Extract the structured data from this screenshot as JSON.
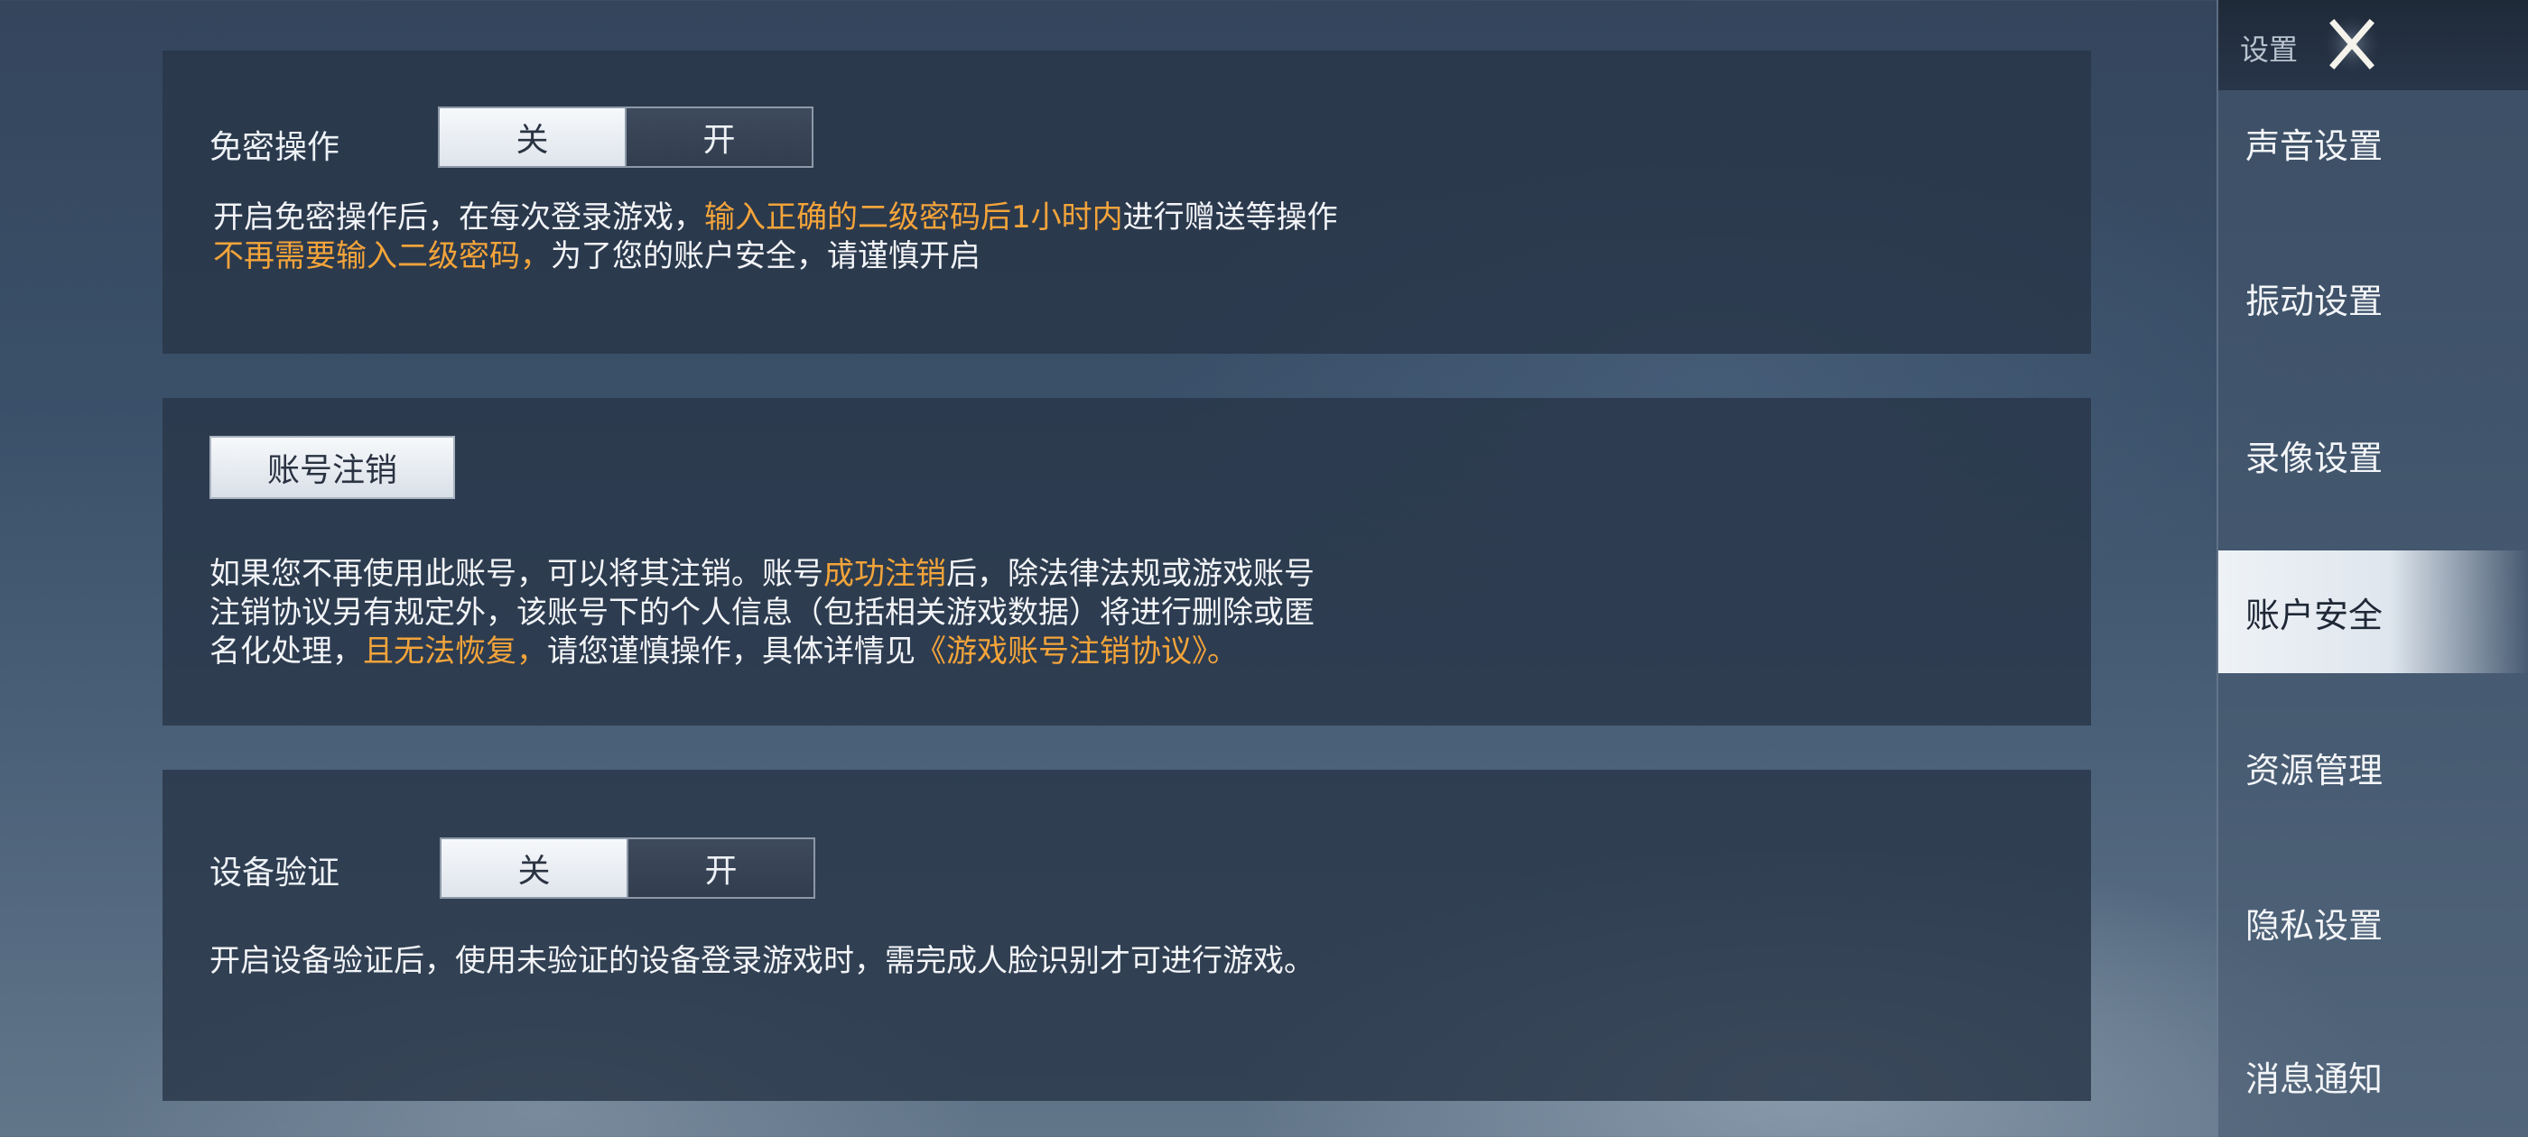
{
  "password_free": {
    "label": "免密操作",
    "toggle": {
      "off_label": "关",
      "on_label": "开",
      "selected": "关"
    },
    "desc": {
      "l1_a": "开启免密操作后，在每次登录游戏，",
      "l1_b": "输入正确的二级密码后1小时内",
      "l1_c": "进行赠送等操作",
      "l2_a": "不再需要输入二级密码，",
      "l2_b": "为了您的账户安全，请谨慎开启"
    }
  },
  "account_cancel": {
    "button_label": "账号注销",
    "desc": {
      "l1_a": "如果您不再使用此账号，可以将其注销。账号",
      "l1_b": "成功注销",
      "l1_c": "后，除法律法规或游戏账号",
      "l2": "注销协议另有规定外，该账号下的个人信息（包括相关游戏数据）将进行删除或匿",
      "l3_a": "名化处理，",
      "l3_b": "且无法恢复，",
      "l3_c": "请您谨慎操作，具体详情见",
      "l3_link": "《游戏账号注销协议》。"
    }
  },
  "device_verify": {
    "label": "设备验证",
    "toggle": {
      "off_label": "关",
      "on_label": "开",
      "selected": "关"
    },
    "desc": "开启设备验证后，使用未验证的设备登录游戏时，需完成人脸识别才可进行游戏。"
  },
  "sidebar": {
    "title": "设置",
    "close_icon": "close-icon",
    "items": [
      {
        "label": "声音设置",
        "active": false
      },
      {
        "label": "振动设置",
        "active": false
      },
      {
        "label": "录像设置",
        "active": false
      },
      {
        "label": "账户安全",
        "active": true
      },
      {
        "label": "资源管理",
        "active": false
      },
      {
        "label": "隐私设置",
        "active": false
      },
      {
        "label": "消息通知",
        "active": false
      }
    ]
  },
  "colors": {
    "highlight": "#f3a43a",
    "panel_bg": "#283648",
    "active_nav_bg": "#eef2f6"
  }
}
